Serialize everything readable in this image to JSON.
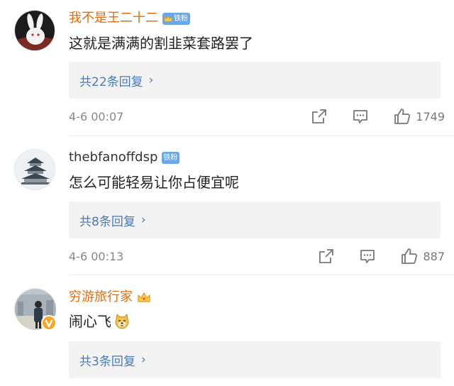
{
  "comments": [
    {
      "username": "我不是王二十二",
      "badge": "铁粉",
      "text": "这就是满满的割韭菜套路罢了",
      "replies_label": "共22条回复",
      "time": "4-6 00:07",
      "likes": "1749",
      "username_color": "#e86b0a",
      "avatar_icon": "rabbit-avatar"
    },
    {
      "username": "thebfanoffdsp",
      "badge": "铁粉",
      "text": "怎么可能轻易让你占便宜呢",
      "replies_label": "共8条回复",
      "time": "4-6 00:13",
      "likes": "887",
      "username_color": "#333333",
      "avatar_icon": "temple-of-heaven-avatar"
    },
    {
      "username": "穷游旅行家",
      "text": "闹心飞",
      "emoji": "doge-emoji",
      "replies_label": "共3条回复",
      "username_color": "#e86b0a",
      "avatar_icon": "traveler-photo-avatar"
    }
  ]
}
